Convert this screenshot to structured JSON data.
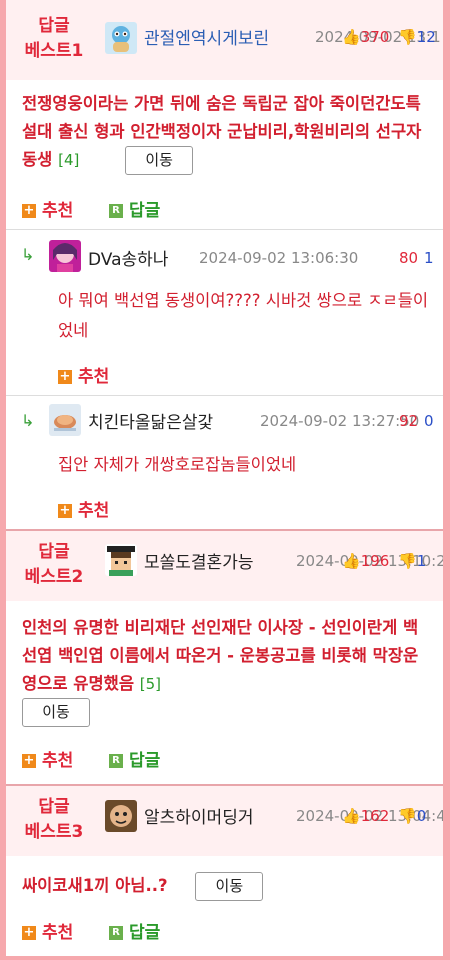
{
  "posts": [
    {
      "badge_line1": "답글",
      "badge_line2": "베스트1",
      "nickname": "관절엔역시게보린",
      "date": "2024-09-02 13:1",
      "up": "370",
      "down": "12",
      "title": "전쟁영웅이라는 가면 뒤에 숨은 독립군 잡아 죽이던간도특설대 출신 형과 인간백정이자 군납비리,학원비리의 선구자 동생",
      "comment_count": "[4]",
      "move_label": "이동",
      "recommend_label": "추천",
      "reply_label": "답글",
      "comments": [
        {
          "nickname": "DVa송하나",
          "date": "2024-09-02 13:06:30",
          "up": "80",
          "down": "1",
          "text": "아 뭐여 백선엽 동생이여???? 시바것 쌍으로 ㅈㄹ들이었네",
          "recommend_label": "추천"
        },
        {
          "nickname": "치킨타올닮은살갗",
          "date": "2024-09-02 13:27:50",
          "up": "92",
          "down": "0",
          "text": "집안 자체가 개쌍호로잡놈들이었네",
          "recommend_label": "추천"
        }
      ]
    },
    {
      "badge_line1": "답글",
      "badge_line2": "베스트2",
      "nickname": "모쏠도결혼가능",
      "date": "2024-09-02 13:10:2",
      "up": "196",
      "down": "1",
      "title": "인천의 유명한 비리재단 선인재단 이사장 - 선인이란게 백선엽 백인엽 이름에서 따온거 - 운봉공고를 비롯해 막장운영으로 유명했음",
      "comment_count": "[5]",
      "move_label": "이동",
      "recommend_label": "추천",
      "reply_label": "답글"
    },
    {
      "badge_line1": "답글",
      "badge_line2": "베스트3",
      "nickname": "알츠하이머딩거",
      "date": "2024-09-02 13:04:4",
      "up": "162",
      "down": "0",
      "title": "싸이코새1끼 아님..?",
      "move_label": "이동",
      "recommend_label": "추천",
      "reply_label": "답글"
    }
  ],
  "colors": {
    "accent_red": "#e0283a",
    "down_blue": "#2b4fc7",
    "header_band": "#fff0f1",
    "frame_border": "#f6a8ad",
    "comment_green": "#2a9a2a"
  }
}
